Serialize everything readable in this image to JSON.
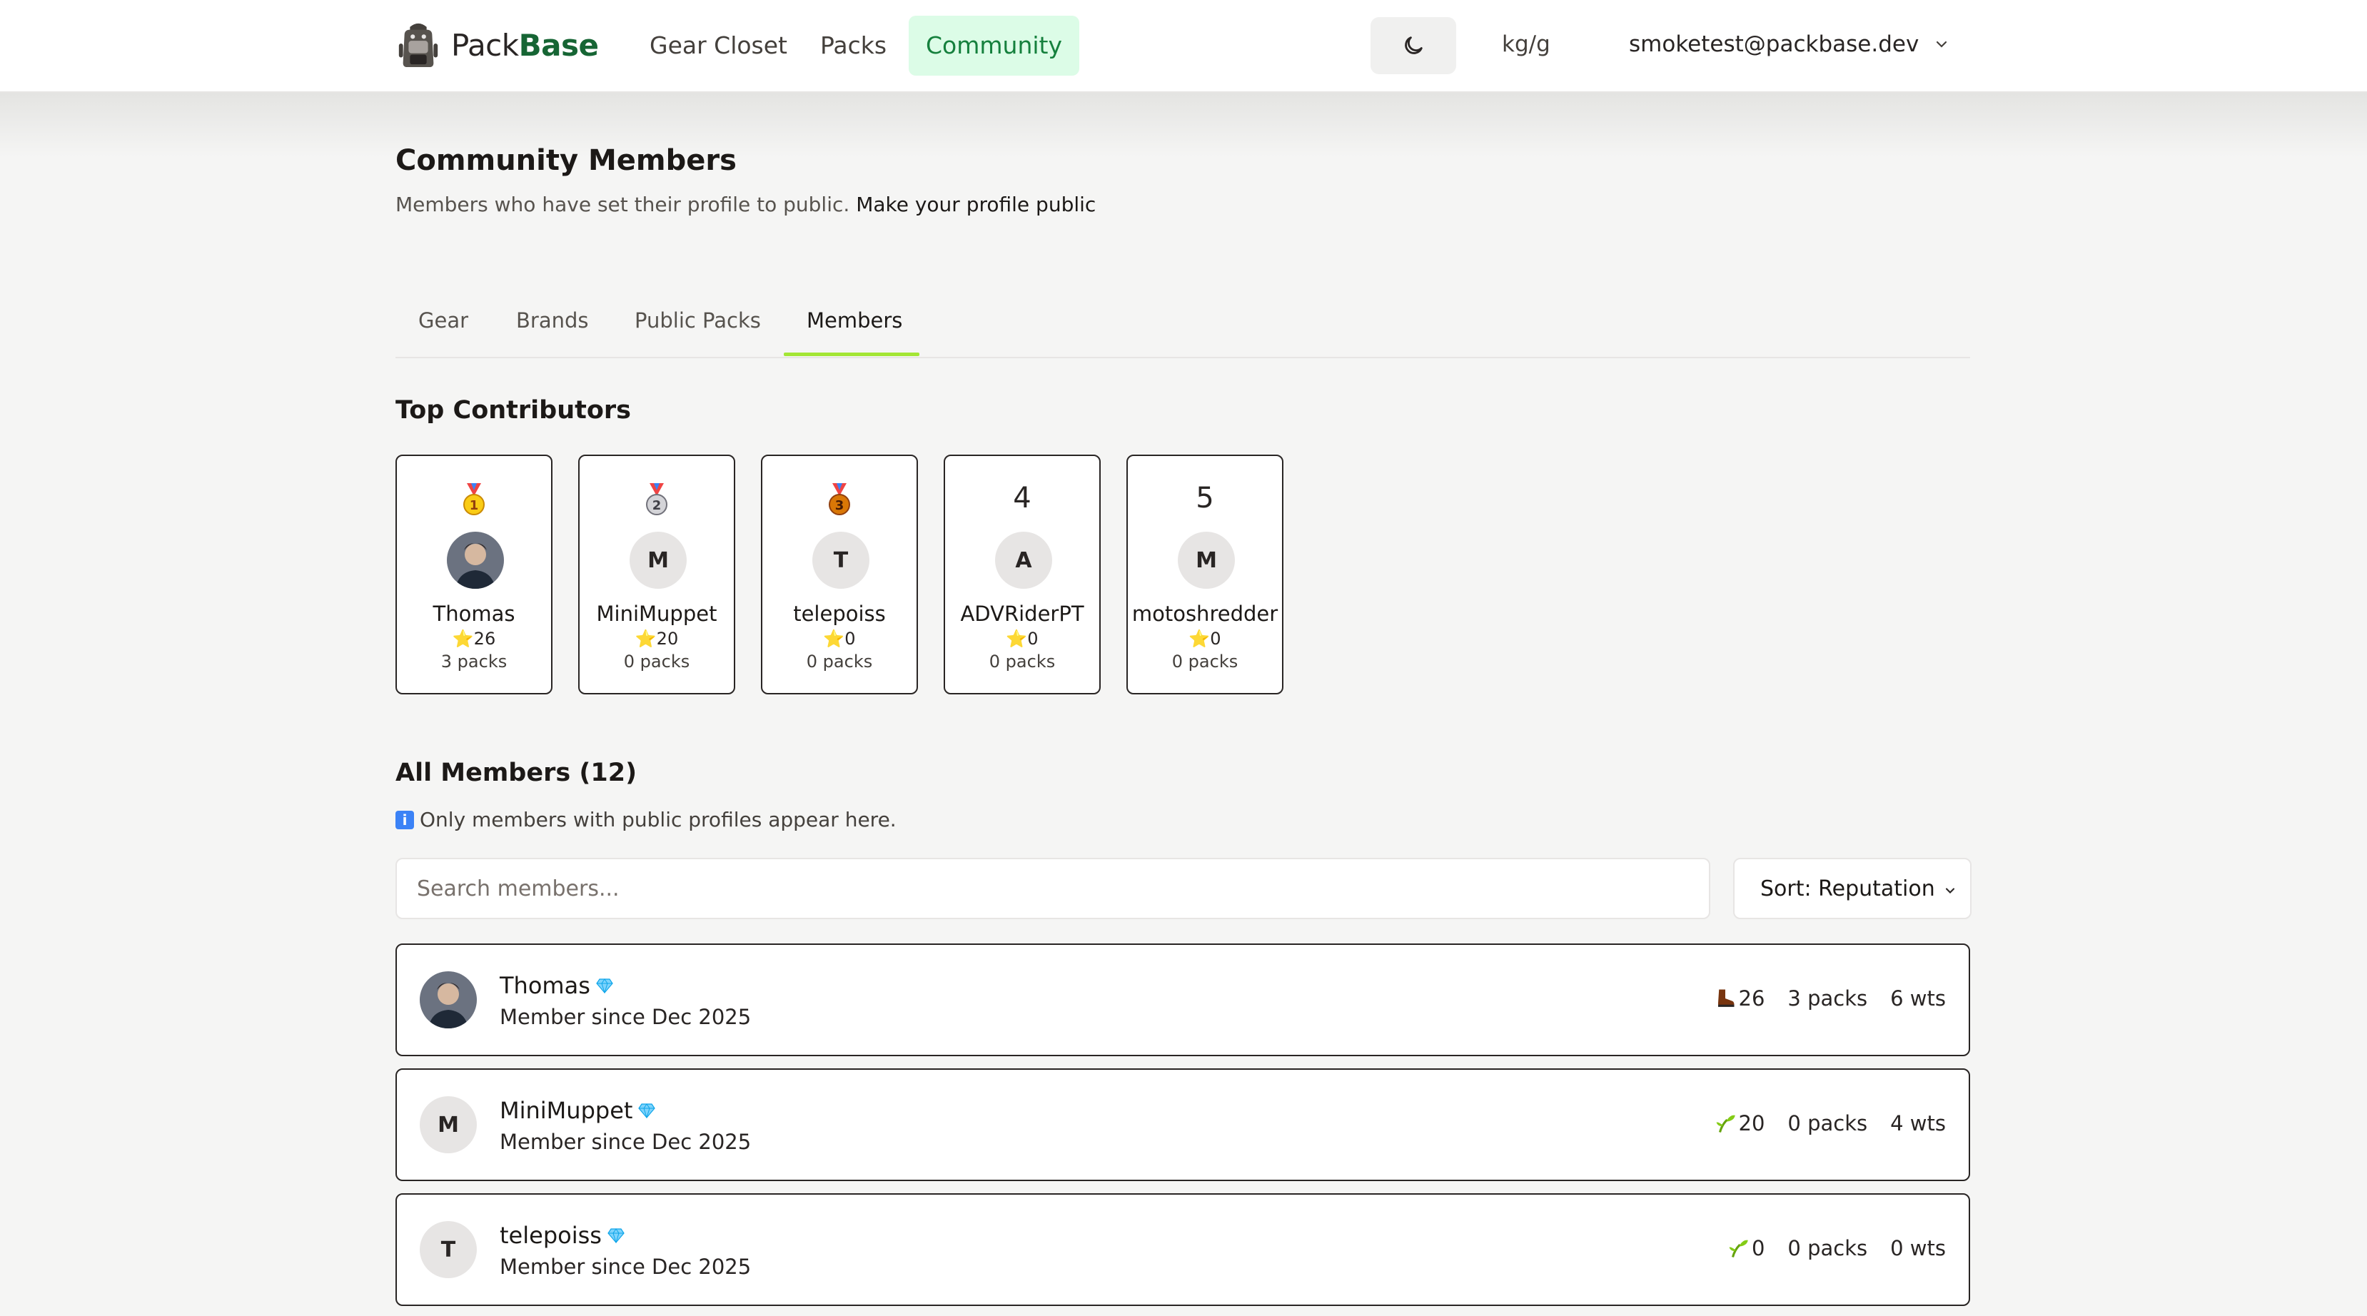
{
  "app": {
    "brand_part1": "Pack",
    "brand_part2": "Base"
  },
  "nav": {
    "links": [
      {
        "label": "Gear Closet",
        "active": false
      },
      {
        "label": "Packs",
        "active": false
      },
      {
        "label": "Community",
        "active": true
      }
    ],
    "theme_icon": "moon-icon",
    "units": "kg/g",
    "account": "smoketest@packbase.dev"
  },
  "header": {
    "title": "Community Members",
    "subtitle": "Members who have set their profile to public.",
    "subtitle_link": "Make your profile public"
  },
  "tabs": [
    {
      "label": "Gear",
      "active": false
    },
    {
      "label": "Brands",
      "active": false
    },
    {
      "label": "Public Packs",
      "active": false
    },
    {
      "label": "Members",
      "active": true
    }
  ],
  "top_contributors": {
    "title": "Top Contributors",
    "cards": [
      {
        "rank": "1",
        "medal": "gold-medal-icon",
        "initial": "",
        "avatar": "photo",
        "name": "Thomas",
        "reputation": "26",
        "packs": "3 packs"
      },
      {
        "rank": "2",
        "medal": "silver-medal-icon",
        "initial": "M",
        "name": "MiniMuppet",
        "reputation": "20",
        "packs": "0 packs"
      },
      {
        "rank": "3",
        "medal": "bronze-medal-icon",
        "initial": "T",
        "name": "telepoiss",
        "reputation": "0",
        "packs": "0 packs"
      },
      {
        "rank": "4",
        "medal": "",
        "initial": "A",
        "name": "ADVRiderPT",
        "reputation": "0",
        "packs": "0 packs"
      },
      {
        "rank": "5",
        "medal": "",
        "initial": "M",
        "name": "motoshredder",
        "reputation": "0",
        "packs": "0 packs"
      }
    ]
  },
  "all_members": {
    "title": "All Members (12)",
    "info": "Only members with public profiles appear here.",
    "search_placeholder": "Search members...",
    "sort_label": "Sort: Reputation",
    "rows": [
      {
        "initial": "",
        "avatar": "photo",
        "name": "Thomas",
        "badge": "diamond-icon",
        "since": "Member since Dec 2025",
        "rep_icon": "boot-icon",
        "reputation": "26",
        "packs": "3 packs",
        "wts": "6 wts"
      },
      {
        "initial": "M",
        "name": "MiniMuppet",
        "badge": "diamond-icon",
        "since": "Member since Dec 2025",
        "rep_icon": "sprout-icon",
        "reputation": "20",
        "packs": "0 packs",
        "wts": "4 wts"
      },
      {
        "initial": "T",
        "name": "telepoiss",
        "badge": "diamond-icon",
        "since": "Member since Dec 2025",
        "rep_icon": "sprout-icon",
        "reputation": "0",
        "packs": "0 packs",
        "wts": "0 wts"
      }
    ]
  },
  "colors": {
    "accent": "#15803d",
    "tab_underline": "#a3e635",
    "active_nav_bg": "#dcfce7"
  }
}
